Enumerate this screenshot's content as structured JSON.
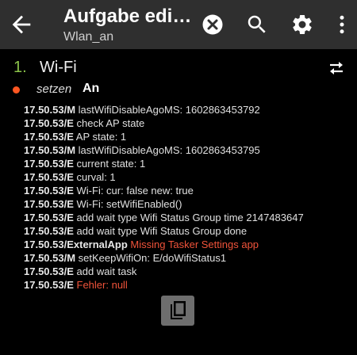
{
  "header": {
    "title": "Aufgabe edi…",
    "subtitle": "Wlan_an"
  },
  "action": {
    "number": "1.",
    "name": "Wi-Fi",
    "param_label": "setzen",
    "param_value": "An"
  },
  "log": [
    {
      "ts": "17.50.53/M",
      "msg": "lastWifiDisableAgoMS: 1602863453792",
      "error": false
    },
    {
      "ts": "17.50.53/E",
      "msg": "check AP state",
      "error": false
    },
    {
      "ts": "17.50.53/E",
      "msg": "AP state: 1",
      "error": false
    },
    {
      "ts": "17.50.53/M",
      "msg": "lastWifiDisableAgoMS: 1602863453795",
      "error": false
    },
    {
      "ts": "17.50.53/E",
      "msg": "current state: 1",
      "error": false
    },
    {
      "ts": "17.50.53/E",
      "msg": "curval: 1",
      "error": false
    },
    {
      "ts": "17.50.53/E",
      "msg": "Wi-Fi: cur: false new: true",
      "error": false
    },
    {
      "ts": "17.50.53/E",
      "msg": "Wi-Fi: setWifiEnabled()",
      "error": false
    },
    {
      "ts": "17.50.53/E",
      "msg": "add wait type Wifi Status Group time 2147483647",
      "error": false
    },
    {
      "ts": "17.50.53/E",
      "msg": "add wait type Wifi Status Group done",
      "error": false
    },
    {
      "ts": "17.50.53/ExternalApp",
      "msg": "Missing Tasker Settings app",
      "error": true
    },
    {
      "ts": "17.50.53/M",
      "msg": "setKeepWifiOn: E/doWifiStatus1",
      "error": false
    },
    {
      "ts": "17.50.53/E",
      "msg": "add wait task",
      "error": false
    },
    {
      "ts": "17.50.53/E",
      "msg": "Fehler: null",
      "error": true
    }
  ],
  "colors": {
    "appbar": "#2f2f2f",
    "action_number": "#8bc34a",
    "param_dot": "#ff5722",
    "error_text": "#f0533a"
  },
  "icons": [
    "back-arrow-icon",
    "clear-icon",
    "search-icon",
    "gear-icon",
    "more-vert-icon",
    "swap-icon",
    "copy-icon"
  ]
}
